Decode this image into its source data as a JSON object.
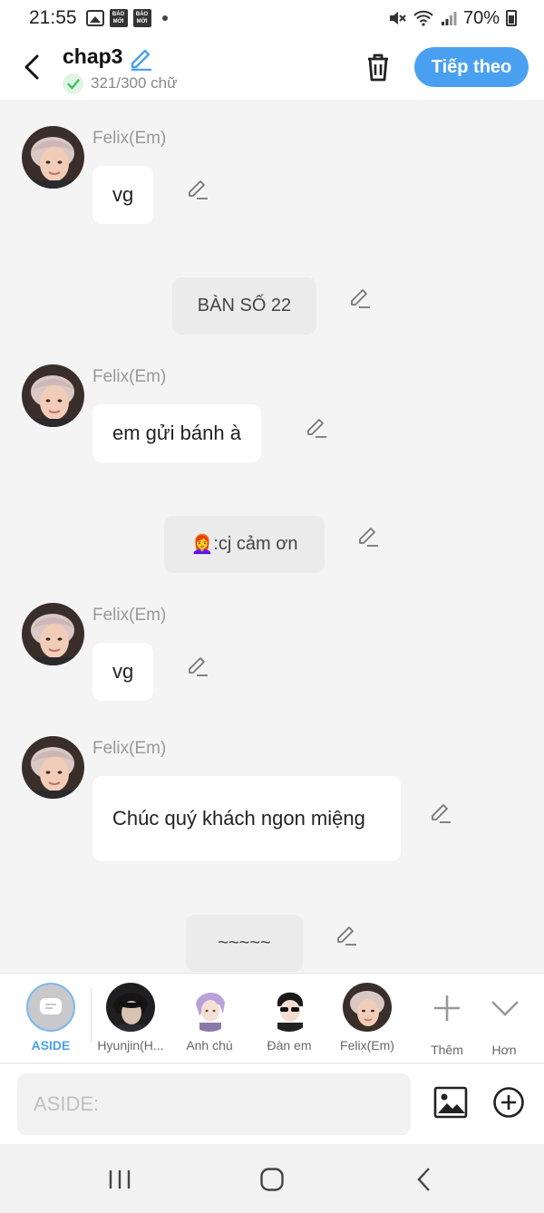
{
  "status_bar": {
    "time": "21:55",
    "battery": "70%",
    "news_badge": "BÁO MỚI"
  },
  "header": {
    "title": "chap3",
    "word_count": "321/300 chữ",
    "next_label": "Tiếp theo"
  },
  "messages": [
    {
      "type": "dialogue",
      "sender": "Felix(Em)",
      "text": "vg"
    },
    {
      "type": "narration",
      "text": "BÀN SỐ 22"
    },
    {
      "type": "dialogue",
      "sender": "Felix(Em)",
      "text": "em gửi bánh à"
    },
    {
      "type": "narration",
      "emoji": "👩‍🦰",
      "text": ":cj cảm ơn"
    },
    {
      "type": "dialogue",
      "sender": "Felix(Em)",
      "text": "vg"
    },
    {
      "type": "dialogue",
      "sender": "Felix(Em)",
      "text": "Chúc quý khách ngon miệng"
    },
    {
      "type": "narration",
      "text": "~~~~~"
    }
  ],
  "characters": [
    {
      "label": "ASIDE",
      "active": true
    },
    {
      "label": "Hyunjin(H..."
    },
    {
      "label": "Anh chú"
    },
    {
      "label": "Đàn em"
    },
    {
      "label": "Felix(Em)"
    },
    {
      "label": "Thêm",
      "icon": "plus-icon"
    },
    {
      "label": "Hơn",
      "icon": "chevron-down-icon"
    }
  ],
  "input": {
    "placeholder": "ASIDE:"
  },
  "colors": {
    "accent": "#4aa0f0",
    "bubble": "#ffffff",
    "narration_bg": "#ebebeb",
    "chat_bg": "#f4f4f5"
  }
}
